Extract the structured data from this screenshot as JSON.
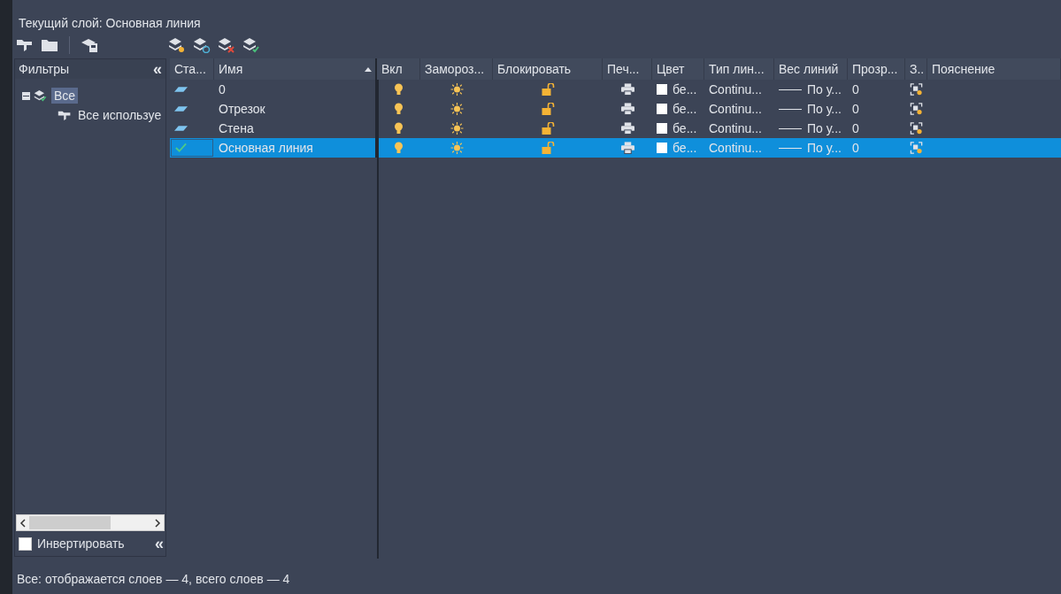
{
  "title": "Текущий слой: Основная линия",
  "filters": {
    "header": "Фильтры",
    "collapse": "«",
    "tree": [
      {
        "label": "Все",
        "selected": true,
        "expanded": true,
        "children": [
          {
            "label": "Все используе",
            "selected": false
          }
        ]
      }
    ],
    "invert": {
      "label": "Инвертировать",
      "checked": false
    },
    "collapse_bottom": "«"
  },
  "columns": [
    {
      "label": "Ста...",
      "sorted": false
    },
    {
      "label": "Имя",
      "sorted": true
    },
    {
      "label": "Вкл",
      "sorted": false
    },
    {
      "label": "Замороз...",
      "sorted": false
    },
    {
      "label": "Блокировать",
      "sorted": false
    },
    {
      "label": "Печ...",
      "sorted": false
    },
    {
      "label": "Цвет",
      "sorted": false
    },
    {
      "label": "Тип лин...",
      "sorted": false
    },
    {
      "label": "Вес линий",
      "sorted": false
    },
    {
      "label": "Прозр...",
      "sorted": false
    },
    {
      "label": "З..",
      "sorted": false
    },
    {
      "label": "Пояснение",
      "sorted": false
    }
  ],
  "rows": [
    {
      "current": false,
      "name": "0",
      "selected": false,
      "on": true,
      "frozen": false,
      "locked": false,
      "plot": true,
      "color_name": "бе...",
      "linetype": "Continu...",
      "lineweight": "По у...",
      "transparency": "0"
    },
    {
      "current": false,
      "name": "Отрезок",
      "selected": false,
      "on": true,
      "frozen": false,
      "locked": false,
      "plot": true,
      "color_name": "бе...",
      "linetype": "Continu...",
      "lineweight": "По у...",
      "transparency": "0"
    },
    {
      "current": false,
      "name": "Стена",
      "selected": false,
      "on": true,
      "frozen": false,
      "locked": false,
      "plot": true,
      "color_name": "бе...",
      "linetype": "Continu...",
      "lineweight": "По у...",
      "transparency": "0"
    },
    {
      "current": true,
      "name": "Основная линия",
      "selected": true,
      "on": true,
      "frozen": false,
      "locked": false,
      "plot": true,
      "color_name": "бе...",
      "linetype": "Continu...",
      "lineweight": "По у...",
      "transparency": "0"
    }
  ],
  "status_bar": "Все: отображается слоев — 4, всего слоев — 4"
}
